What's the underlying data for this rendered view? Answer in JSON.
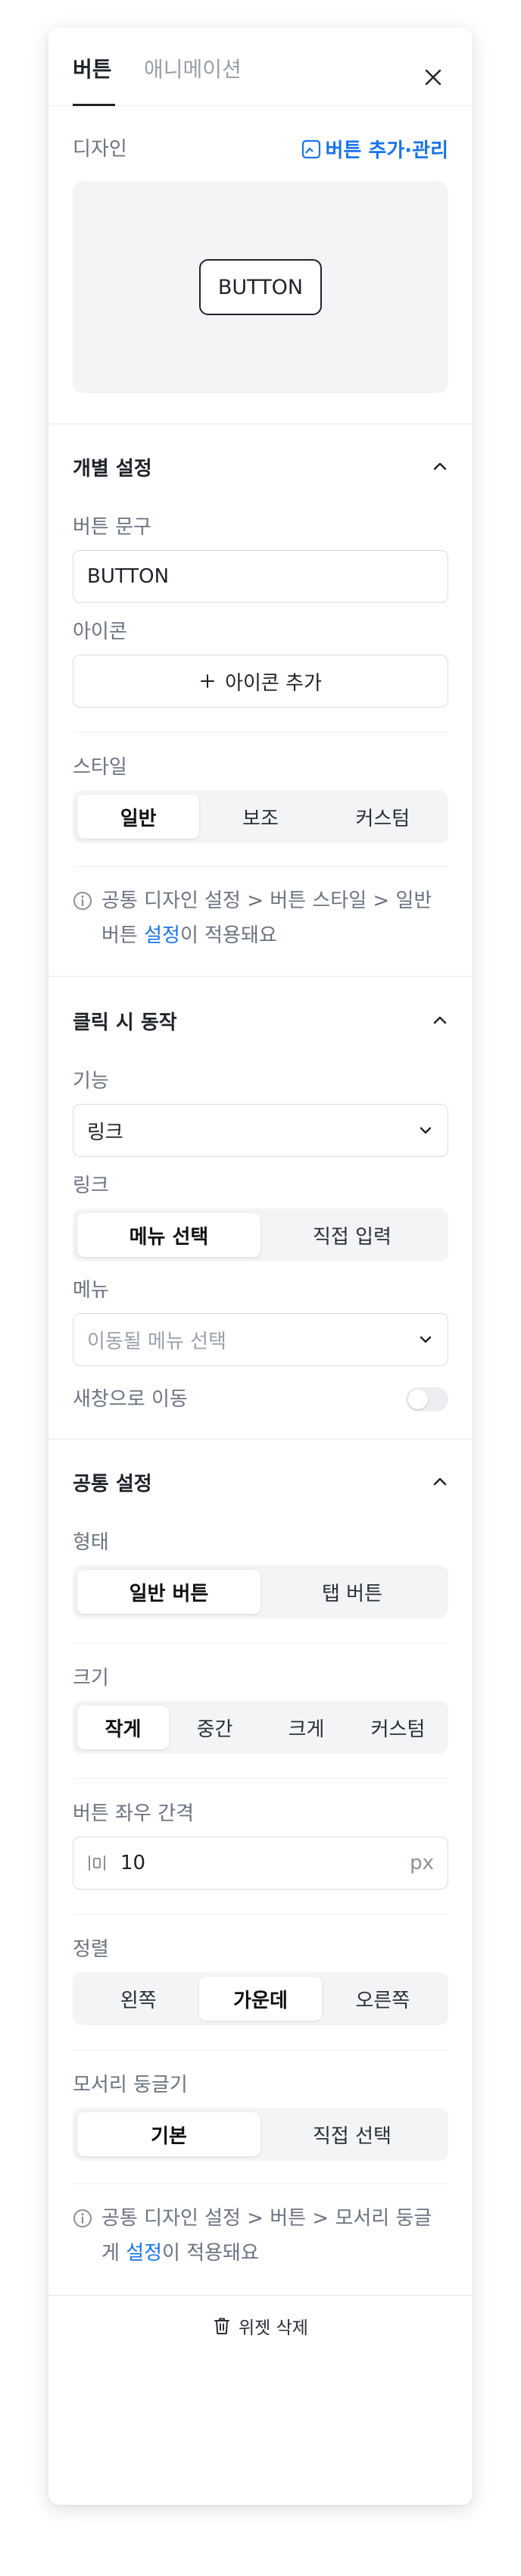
{
  "tabs": {
    "button": "버튼",
    "animation": "애니메이션"
  },
  "design": {
    "label": "디자인",
    "manage_link": "버튼 추가·관리",
    "preview_button": "BUTTON"
  },
  "individual": {
    "title": "개별 설정",
    "text_label": "버튼 문구",
    "text_value": "BUTTON",
    "icon_label": "아이콘",
    "add_icon": "아이콘 추가",
    "style_label": "스타일",
    "style_options": [
      "일반",
      "보조",
      "커스텀"
    ],
    "style_selected": "일반",
    "notice_prefix": "공통 디자인 설정 > 버튼 스타일 > 일반 버튼 ",
    "notice_link": "설정",
    "notice_suffix": "이 적용돼요"
  },
  "click": {
    "title": "클릭 시 동작",
    "function_label": "기능",
    "function_value": "링크",
    "link_label": "링크",
    "link_options": [
      "메뉴 선택",
      "직접 입력"
    ],
    "link_selected": "메뉴 선택",
    "menu_label": "메뉴",
    "menu_placeholder": "이동될 메뉴 선택",
    "new_window_label": "새창으로 이동",
    "new_window_on": false
  },
  "common": {
    "title": "공통 설정",
    "shape_label": "형태",
    "shape_options": [
      "일반 버튼",
      "탭 버튼"
    ],
    "shape_selected": "일반 버튼",
    "size_label": "크기",
    "size_options": [
      "작게",
      "중간",
      "크게",
      "커스텀"
    ],
    "size_selected": "작게",
    "spacing_label": "버튼 좌우 간격",
    "spacing_value": "10",
    "spacing_unit": "px",
    "align_label": "정렬",
    "align_options": [
      "왼쪽",
      "가운데",
      "오른쪽"
    ],
    "align_selected": "가운데",
    "radius_label": "모서리 둥글기",
    "radius_options": [
      "기본",
      "직접 선택"
    ],
    "radius_selected": "기본",
    "notice_prefix": "공통 디자인 설정 > 버튼 > 모서리 둥글게 ",
    "notice_link": "설정",
    "notice_suffix": "이 적용돼요"
  },
  "footer": {
    "delete_label": "위젯 삭제"
  },
  "colors": {
    "accent": "#1a73e8",
    "text": "#1f2329",
    "muted": "#6b7280",
    "segment_bg": "#f3f4f6"
  }
}
